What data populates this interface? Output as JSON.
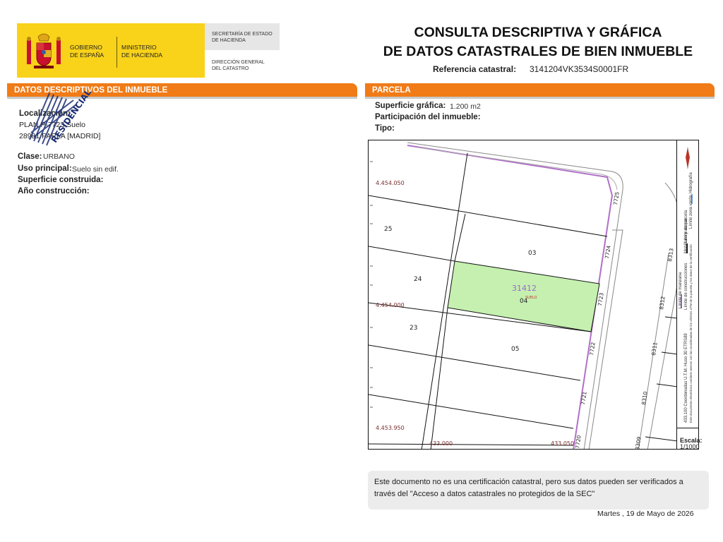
{
  "header": {
    "gov_line1": "GOBIERNO",
    "gov_line2": "DE ESPAÑA",
    "min_line1": "MINISTERIO",
    "min_line2": "DE HACIENDA",
    "sec_line1": "SECRETARÍA DE ESTADO",
    "sec_line2": "DE HACIENDA",
    "dir_line1": "DIRECCIÓN GENERAL",
    "dir_line2": "DEL CATASTRO",
    "title_line1": "CONSULTA DESCRIPTIVA Y GRÁFICA",
    "title_line2": "DE DATOS CATASTRALES DE BIEN INMUEBLE",
    "ref_label": "Referencia catastral:",
    "ref_value": "3141204VK3534S0001FR",
    "gov_color": "#f9d21a"
  },
  "left": {
    "section_title": "DATOS DESCRIPTIVOS DEL INMUEBLE",
    "localizacion_label": "Localización:",
    "localizacion_line1": "PLAN P-7723 Suelo",
    "localizacion_line2": "28981 PARLA [MADRID]",
    "clase_label": "Clase:",
    "clase_value": "URBANO",
    "uso_label": "Uso principal:",
    "uso_value": "Suelo sin edif.",
    "superficie_label": "Superficie construida:",
    "anio_label": "Año construcción:",
    "stamp_text": "RESIDENCIAL"
  },
  "right": {
    "section_title": "PARCELA",
    "superficie_label": "Superficie gráfica:",
    "superficie_value": "1.200 m2",
    "participacion_label": "Participación del inmueble:",
    "tipo_label": "Tipo:"
  },
  "map": {
    "y_coords": [
      "4.454.050",
      "4.454.000",
      "4.453.950"
    ],
    "x_coords": [
      "433.000",
      "433.050"
    ],
    "parcels": [
      "25",
      "24",
      "23",
      "03",
      "04",
      "05"
    ],
    "highlight_code": "31412",
    "highlight_sublabel": "SUELO",
    "street_numbers": [
      "7725",
      "7724",
      "7723",
      "7722",
      "7721",
      "7720",
      "8313",
      "8312",
      "8311",
      "8310",
      "8309"
    ],
    "highlight_color": "#c5f0b0",
    "boundary_color": "#b070c8",
    "scale_label": "Escala:",
    "scale_value": "1/1000",
    "legend_lines": [
      "Límite de manzana",
      "Límite de parcela",
      "Hidrografía",
      "Límite de construcciones",
      "Mobiliario y aceras",
      "Límite zona verde",
      "433.100 Coordenadas U.T.M. Huso 30 ETRS89",
      "Este documento electrónico contiene anexos con las coordenadas de los vértices UTM de la parcela y los datos de la certificación"
    ]
  },
  "notice": {
    "text": "Este documento no es una certificación catastral, pero sus datos pueden ser verificados a través del \"Acceso a datos catastrales no protegidos de la SEC\""
  },
  "footer": {
    "date": "Martes , 19 de Mayo de 2026"
  }
}
